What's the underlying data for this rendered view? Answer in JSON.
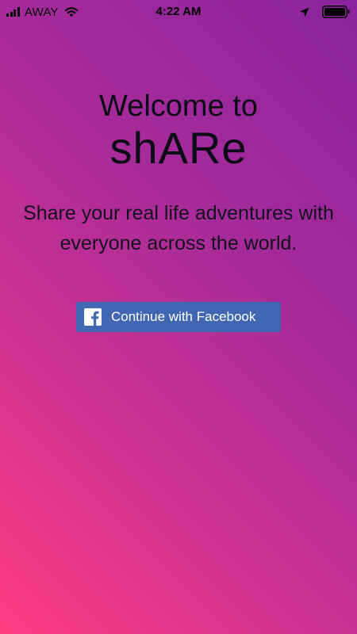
{
  "status_bar": {
    "carrier": "AWAY",
    "time": "4:22 AM"
  },
  "welcome": {
    "line1": "Welcome to",
    "app_name": "shARe",
    "tagline": "Share your real life adventures with everyone across the world."
  },
  "facebook_button": {
    "label": "Continue with Facebook",
    "icon": "facebook-icon"
  },
  "colors": {
    "gradient_bottom_left": "#ff3d7f",
    "gradient_top_right": "#8a249e",
    "facebook_blue": "#4267b2",
    "text_dark": "#0c0c16"
  }
}
